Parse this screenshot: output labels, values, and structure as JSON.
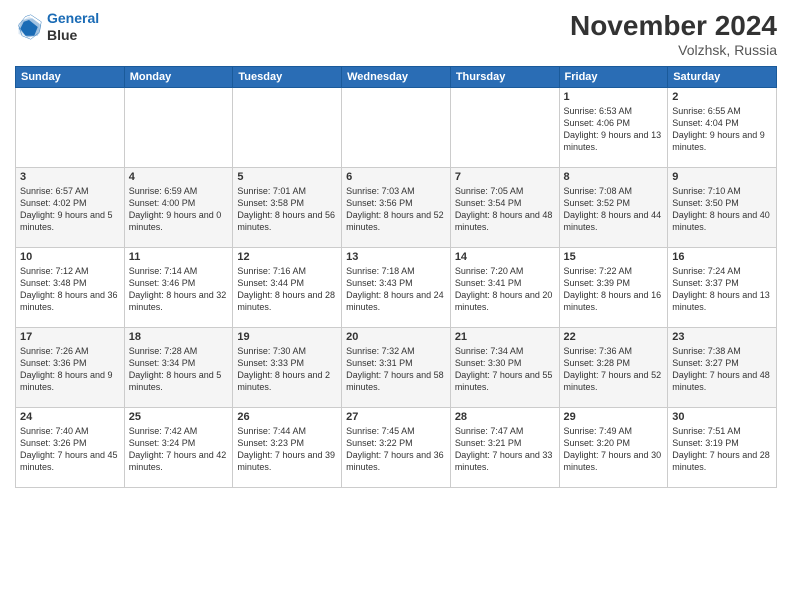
{
  "header": {
    "logo_line1": "General",
    "logo_line2": "Blue",
    "month": "November 2024",
    "location": "Volzhsk, Russia"
  },
  "weekdays": [
    "Sunday",
    "Monday",
    "Tuesday",
    "Wednesday",
    "Thursday",
    "Friday",
    "Saturday"
  ],
  "weeks": [
    [
      {
        "day": "",
        "info": ""
      },
      {
        "day": "",
        "info": ""
      },
      {
        "day": "",
        "info": ""
      },
      {
        "day": "",
        "info": ""
      },
      {
        "day": "",
        "info": ""
      },
      {
        "day": "1",
        "info": "Sunrise: 6:53 AM\nSunset: 4:06 PM\nDaylight: 9 hours\nand 13 minutes."
      },
      {
        "day": "2",
        "info": "Sunrise: 6:55 AM\nSunset: 4:04 PM\nDaylight: 9 hours\nand 9 minutes."
      }
    ],
    [
      {
        "day": "3",
        "info": "Sunrise: 6:57 AM\nSunset: 4:02 PM\nDaylight: 9 hours\nand 5 minutes."
      },
      {
        "day": "4",
        "info": "Sunrise: 6:59 AM\nSunset: 4:00 PM\nDaylight: 9 hours\nand 0 minutes."
      },
      {
        "day": "5",
        "info": "Sunrise: 7:01 AM\nSunset: 3:58 PM\nDaylight: 8 hours\nand 56 minutes."
      },
      {
        "day": "6",
        "info": "Sunrise: 7:03 AM\nSunset: 3:56 PM\nDaylight: 8 hours\nand 52 minutes."
      },
      {
        "day": "7",
        "info": "Sunrise: 7:05 AM\nSunset: 3:54 PM\nDaylight: 8 hours\nand 48 minutes."
      },
      {
        "day": "8",
        "info": "Sunrise: 7:08 AM\nSunset: 3:52 PM\nDaylight: 8 hours\nand 44 minutes."
      },
      {
        "day": "9",
        "info": "Sunrise: 7:10 AM\nSunset: 3:50 PM\nDaylight: 8 hours\nand 40 minutes."
      }
    ],
    [
      {
        "day": "10",
        "info": "Sunrise: 7:12 AM\nSunset: 3:48 PM\nDaylight: 8 hours\nand 36 minutes."
      },
      {
        "day": "11",
        "info": "Sunrise: 7:14 AM\nSunset: 3:46 PM\nDaylight: 8 hours\nand 32 minutes."
      },
      {
        "day": "12",
        "info": "Sunrise: 7:16 AM\nSunset: 3:44 PM\nDaylight: 8 hours\nand 28 minutes."
      },
      {
        "day": "13",
        "info": "Sunrise: 7:18 AM\nSunset: 3:43 PM\nDaylight: 8 hours\nand 24 minutes."
      },
      {
        "day": "14",
        "info": "Sunrise: 7:20 AM\nSunset: 3:41 PM\nDaylight: 8 hours\nand 20 minutes."
      },
      {
        "day": "15",
        "info": "Sunrise: 7:22 AM\nSunset: 3:39 PM\nDaylight: 8 hours\nand 16 minutes."
      },
      {
        "day": "16",
        "info": "Sunrise: 7:24 AM\nSunset: 3:37 PM\nDaylight: 8 hours\nand 13 minutes."
      }
    ],
    [
      {
        "day": "17",
        "info": "Sunrise: 7:26 AM\nSunset: 3:36 PM\nDaylight: 8 hours\nand 9 minutes."
      },
      {
        "day": "18",
        "info": "Sunrise: 7:28 AM\nSunset: 3:34 PM\nDaylight: 8 hours\nand 5 minutes."
      },
      {
        "day": "19",
        "info": "Sunrise: 7:30 AM\nSunset: 3:33 PM\nDaylight: 8 hours\nand 2 minutes."
      },
      {
        "day": "20",
        "info": "Sunrise: 7:32 AM\nSunset: 3:31 PM\nDaylight: 7 hours\nand 58 minutes."
      },
      {
        "day": "21",
        "info": "Sunrise: 7:34 AM\nSunset: 3:30 PM\nDaylight: 7 hours\nand 55 minutes."
      },
      {
        "day": "22",
        "info": "Sunrise: 7:36 AM\nSunset: 3:28 PM\nDaylight: 7 hours\nand 52 minutes."
      },
      {
        "day": "23",
        "info": "Sunrise: 7:38 AM\nSunset: 3:27 PM\nDaylight: 7 hours\nand 48 minutes."
      }
    ],
    [
      {
        "day": "24",
        "info": "Sunrise: 7:40 AM\nSunset: 3:26 PM\nDaylight: 7 hours\nand 45 minutes."
      },
      {
        "day": "25",
        "info": "Sunrise: 7:42 AM\nSunset: 3:24 PM\nDaylight: 7 hours\nand 42 minutes."
      },
      {
        "day": "26",
        "info": "Sunrise: 7:44 AM\nSunset: 3:23 PM\nDaylight: 7 hours\nand 39 minutes."
      },
      {
        "day": "27",
        "info": "Sunrise: 7:45 AM\nSunset: 3:22 PM\nDaylight: 7 hours\nand 36 minutes."
      },
      {
        "day": "28",
        "info": "Sunrise: 7:47 AM\nSunset: 3:21 PM\nDaylight: 7 hours\nand 33 minutes."
      },
      {
        "day": "29",
        "info": "Sunrise: 7:49 AM\nSunset: 3:20 PM\nDaylight: 7 hours\nand 30 minutes."
      },
      {
        "day": "30",
        "info": "Sunrise: 7:51 AM\nSunset: 3:19 PM\nDaylight: 7 hours\nand 28 minutes."
      }
    ]
  ]
}
